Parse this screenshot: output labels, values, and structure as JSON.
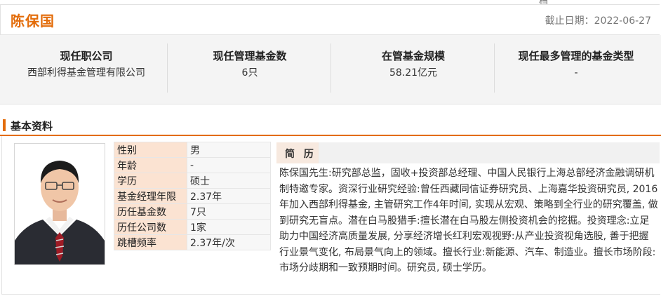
{
  "top_partial_char": "档",
  "header": {
    "name": "陈保国",
    "cutoff_date": "截止日期：2022-06-27"
  },
  "stats": [
    {
      "label": "现任职公司",
      "value": "西部利得基金管理有限公司"
    },
    {
      "label": "现任管理基金数",
      "value": "6只"
    },
    {
      "label": "在管基金规模",
      "value": "58.21亿元"
    },
    {
      "label": "现任最多管理的基金类型",
      "value": "-"
    }
  ],
  "section_title": "基本资料",
  "profile": [
    {
      "key": "性别",
      "value": "男"
    },
    {
      "key": "年龄",
      "value": "-"
    },
    {
      "key": "学历",
      "value": "硕士"
    },
    {
      "key": "基金经理年限",
      "value": "2.37年"
    },
    {
      "key": "历任基金数",
      "value": "7只"
    },
    {
      "key": "历任公司数",
      "value": "1家"
    },
    {
      "key": "跳槽频率",
      "value": "2.37年/次"
    }
  ],
  "resume": {
    "label": "简 历",
    "text": "陈保国先生:研究部总监，固收+投资部总经理、中国人民银行上海总部经济金融调研机制特邀专家。资深行业研究经验:曾任西藏同信证券研究员、上海嘉华投资研究员, 2016年加入西部利得基金, 主管研究工作4年时间, 实现从宏观、策略到全行业的研究覆盖, 做到研究无盲点。潜在白马股猎手:擅长潜在白马股左侧投资机会的挖掘。投资理念:立足助力中国经济高质量发展, 分享经济增长红利宏观视野:从产业投资视角选股, 善于把握行业景气变化, 布局景气向上的领域。擅长行业:新能源、汽车、制造业。擅长市场阶段:市场分歧期和一致预期时间。研究员, 硕士学历。"
  }
}
